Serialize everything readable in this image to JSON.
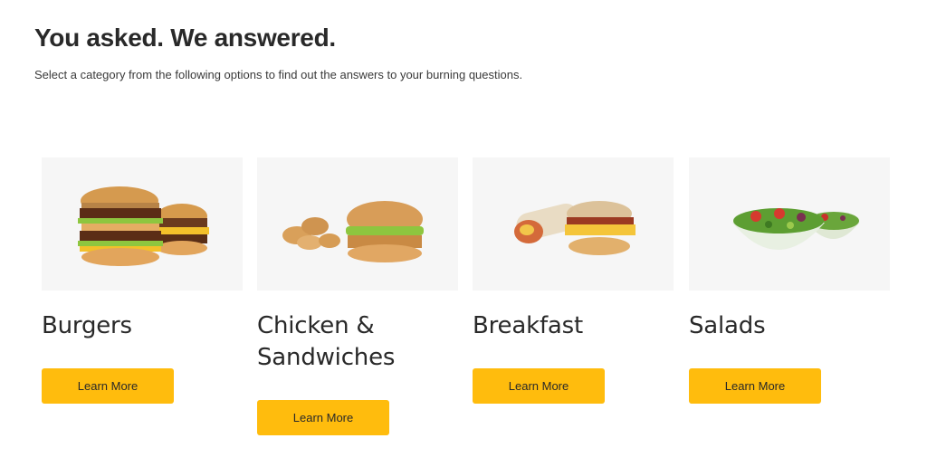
{
  "header": {
    "title": "You asked. We answered.",
    "subtitle": "Select a category from the following options to find out the answers to your burning questions."
  },
  "categories": [
    {
      "label": "Burgers",
      "button": "Learn More",
      "image_icon": "burger-image"
    },
    {
      "label": "Chicken & Sandwiches",
      "button": "Learn More",
      "image_icon": "chicken-sandwich-image"
    },
    {
      "label": "Breakfast",
      "button": "Learn More",
      "image_icon": "breakfast-image"
    },
    {
      "label": "Salads",
      "button": "Learn More",
      "image_icon": "salad-image"
    }
  ],
  "colors": {
    "accent": "#ffbc0d",
    "card_bg": "#f6f6f6",
    "text": "#292929"
  }
}
